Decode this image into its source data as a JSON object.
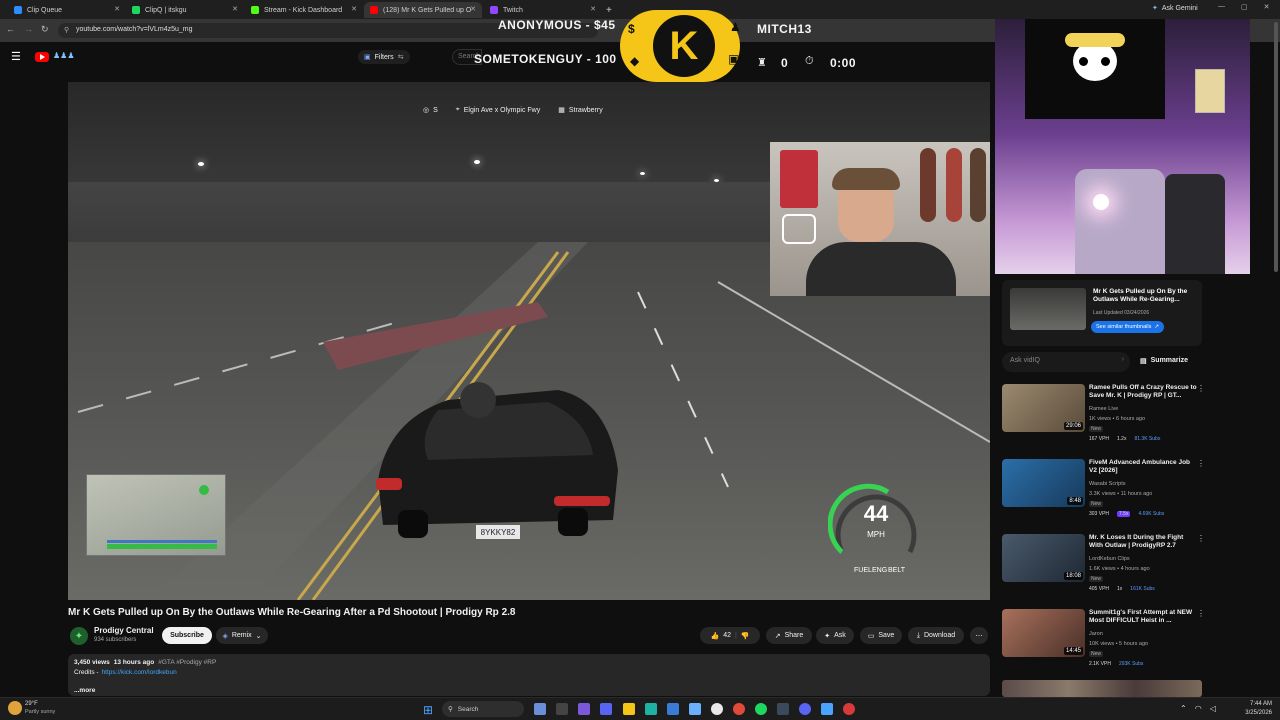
{
  "browser": {
    "tabs": [
      {
        "label": "Clip Queue",
        "color": "#2d8cff",
        "active": false
      },
      {
        "label": "ClipQ | itskgu",
        "color": "#1ed760",
        "active": false
      },
      {
        "label": "Stream - Kick Dashboard",
        "color": "#53fc18",
        "active": false
      },
      {
        "label": "(128) Mr K Gets Pulled up On B",
        "color": "#ff0000",
        "active": true
      },
      {
        "label": "Twitch",
        "color": "#9146ff",
        "active": false
      }
    ],
    "new_tab": "+",
    "ask_gemini": "Ask Gemini",
    "url": "youtube.com/watch?v=lVLm4z5u_mg"
  },
  "youtube": {
    "filters_label": "Filters",
    "search_placeholder": "Search"
  },
  "overlay": {
    "donor1": "ANONYMOUS - $45",
    "donor2": "SOMETOKENGUY - 100",
    "logo_letter": "K",
    "follower": "MITCH13",
    "counter": "0",
    "timer": "0:00"
  },
  "game_hud": {
    "direction": "S",
    "location": "Elgin Ave x Olympic Fwy",
    "area": "Strawberry",
    "speed": "44",
    "speed_unit": "MPH",
    "fuel": "FUEL",
    "eng": "ENG",
    "belt": "BELT",
    "plate": "8YKKY82"
  },
  "video": {
    "title": "Mr K Gets Pulled up On By the Outlaws While Re-Gearing After a Pd Shootout | Prodigy Rp 2.8",
    "channel": "Prodigy Central",
    "subscribers": "934 subscribers",
    "subscribe": "Subscribe",
    "remix": "Remix",
    "likes": "42",
    "share": "Share",
    "ask": "Ask",
    "save": "Save",
    "download": "Download",
    "more_menu": "⋯",
    "views": "3,450 views",
    "age": "13 hours ago",
    "tags": "#GTA #Prodigy #RP",
    "credits_label": "Credits -",
    "credits_link": "https://kick.com/lordkebun",
    "more": "...more"
  },
  "vidiq": {
    "title": "Mr K Gets Pulled up On By the Outlaws While Re-Gearing...",
    "updated": "Last Updated 03/24/2026",
    "button": "See similar thumbnails",
    "ask_placeholder": "Ask vidIQ",
    "summarize": "Summarize"
  },
  "recommendations": [
    {
      "title": "Ramee Pulls Off a Crazy Rescue to Save Mr. K | Prodigy RP | GT...",
      "channel": "Ramee Live",
      "meta": "1K views • 6 hours ago",
      "badge": "New",
      "vph": "167 VPH",
      "mult": "1.2x",
      "subs": "81.3K Subs",
      "duration": "29:06",
      "thumb": "#7d6a55"
    },
    {
      "title": "FiveM Advanced Ambulance Job V2 [2026]",
      "channel": "Wasabi Scripts",
      "meta": "3.3K views • 11 hours ago",
      "badge": "New",
      "vph": "303 VPH",
      "mult": "7.5x",
      "subs": "4.69K Subs",
      "duration": "8:48",
      "thumb": "#2b6fa8"
    },
    {
      "title": "Mr. K Loses It During the Fight With Outlaw | ProdigyRP 2.7",
      "channel": "LordKebun Clips",
      "meta": "1.6K views • 4 hours ago",
      "badge": "New",
      "vph": "405 VPH",
      "mult": "1x",
      "subs": "161K Subs",
      "duration": "18:08",
      "thumb": "#3c4a5c"
    },
    {
      "title": "Summit1g's First Attempt at NEW Most DIFFICULT Heist in ...",
      "channel": "Jaron",
      "meta": "10K views • 5 hours ago",
      "badge": "New",
      "vph": "2.1K VPH",
      "mult": "",
      "subs": "293K Subs",
      "duration": "14:45",
      "thumb": "#8a5a4a"
    }
  ],
  "taskbar": {
    "weather_temp": "29°F",
    "weather_desc": "Partly sunny",
    "search": "Search",
    "time": "7:44 AM",
    "date": "3/25/2026"
  }
}
